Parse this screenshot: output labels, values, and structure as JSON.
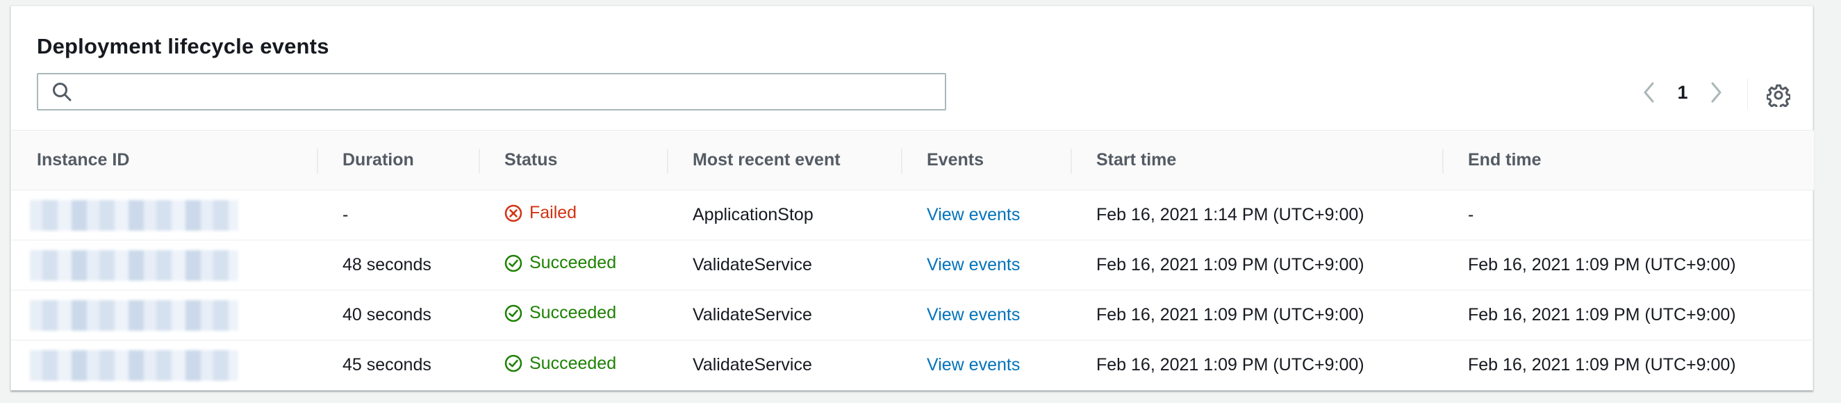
{
  "panel": {
    "title": "Deployment lifecycle events"
  },
  "search": {
    "value": "",
    "placeholder": ""
  },
  "pagination": {
    "current_page": "1"
  },
  "table": {
    "columns": [
      "Instance ID",
      "Duration",
      "Status",
      "Most recent event",
      "Events",
      "Start time",
      "End time"
    ],
    "rows": [
      {
        "instance_id": "",
        "duration": "-",
        "status": "Failed",
        "status_type": "failed",
        "most_recent_event": "ApplicationStop",
        "events_link": "View events",
        "start_time": "Feb 16, 2021 1:14 PM (UTC+9:00)",
        "end_time": "-"
      },
      {
        "instance_id": "",
        "duration": "48 seconds",
        "status": "Succeeded",
        "status_type": "success",
        "most_recent_event": "ValidateService",
        "events_link": "View events",
        "start_time": "Feb 16, 2021 1:09 PM (UTC+9:00)",
        "end_time": "Feb 16, 2021 1:09 PM (UTC+9:00)"
      },
      {
        "instance_id": "",
        "duration": "40 seconds",
        "status": "Succeeded",
        "status_type": "success",
        "most_recent_event": "ValidateService",
        "events_link": "View events",
        "start_time": "Feb 16, 2021 1:09 PM (UTC+9:00)",
        "end_time": "Feb 16, 2021 1:09 PM (UTC+9:00)"
      },
      {
        "instance_id": "",
        "duration": "45 seconds",
        "status": "Succeeded",
        "status_type": "success",
        "most_recent_event": "ValidateService",
        "events_link": "View events",
        "start_time": "Feb 16, 2021 1:09 PM (UTC+9:00)",
        "end_time": "Feb 16, 2021 1:09 PM (UTC+9:00)"
      }
    ]
  },
  "colors": {
    "failed": "#d13212",
    "success": "#1d8102",
    "link": "#0073bb"
  },
  "icons": {
    "search": "search-icon",
    "prev": "chevron-left-icon",
    "next": "chevron-right-icon",
    "settings": "gear-icon",
    "failed": "status-failed-icon",
    "success": "status-success-icon"
  }
}
